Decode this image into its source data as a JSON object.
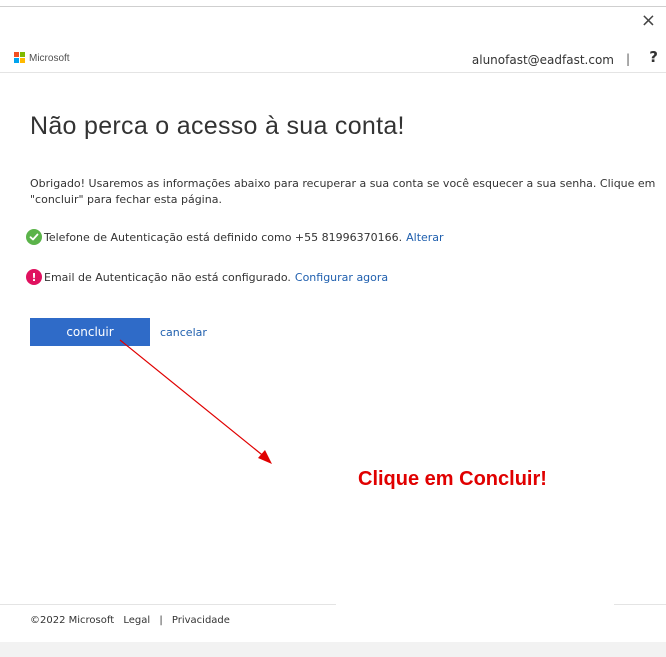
{
  "window": {
    "close_glyph": "×"
  },
  "header": {
    "brand": "Microsoft",
    "account": "alunofast@eadfast.com",
    "separator": "|",
    "help_glyph": "?"
  },
  "page": {
    "title": "Não perca o acesso à sua conta!",
    "intro": "Obrigado! Usaremos as informações abaixo para recuperar a sua conta se você esquecer a sua senha. Clique em \"concluir\" para fechar esta página.",
    "phone": {
      "text": "Telefone de Autenticação está definido como +55 81996370166.",
      "link": "Alterar",
      "icon": "check-circle-icon"
    },
    "email": {
      "text": "Email de Autenticação não está configurado.",
      "link": "Configurar agora",
      "icon": "exclamation-circle-icon"
    },
    "buttons": {
      "primary": "concluir",
      "cancel": "cancelar"
    }
  },
  "annotation": {
    "callout": "Clique em Concluir!"
  },
  "footer": {
    "copyright": "©2022 Microsoft",
    "legal": "Legal",
    "sep": "|",
    "privacy": "Privacidade"
  },
  "colors": {
    "ms_red": "#f25022",
    "ms_green": "#7fba00",
    "ms_blue": "#00a4ef",
    "ms_yellow": "#ffb900",
    "primary_button": "#2f6bc8",
    "link": "#1f5fae",
    "success": "#5bb34a",
    "warning": "#e0115f",
    "callout": "#e00000"
  }
}
